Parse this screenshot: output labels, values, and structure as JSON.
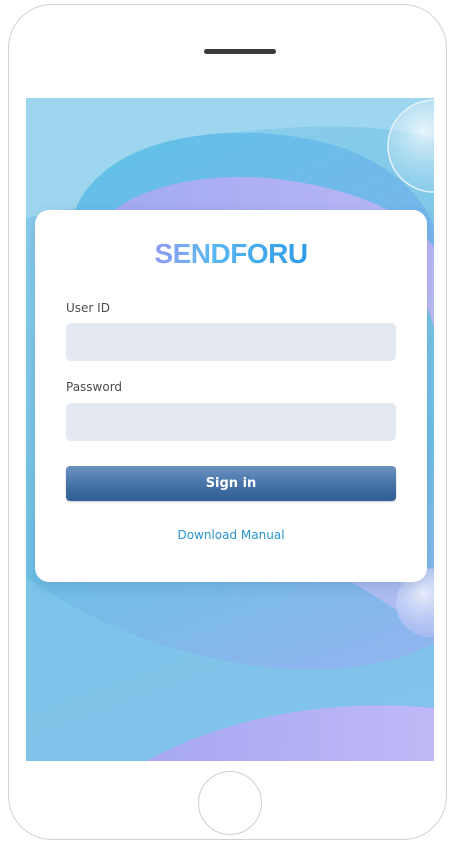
{
  "app": {
    "logo_text": "SENDFORU"
  },
  "login": {
    "user_id_label": "User ID",
    "user_id_value": "",
    "password_label": "Password",
    "password_value": "",
    "sign_in_label": "Sign in",
    "download_manual_label": "Download Manual"
  },
  "colors": {
    "accent_link": "#2a95cf",
    "button_top": "#6d93c2",
    "button_bottom": "#2d5d93",
    "input_bg": "#e3e8f1"
  }
}
